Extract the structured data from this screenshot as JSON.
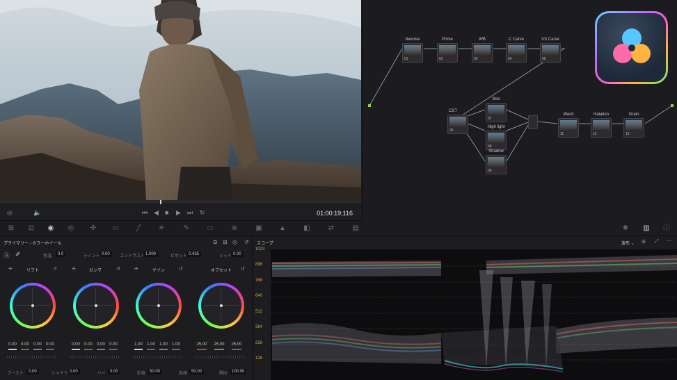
{
  "viewer": {
    "timecode": "01:00:19;116"
  },
  "node_graph": {
    "nodes": [
      {
        "label": "denoise",
        "num": "01"
      },
      {
        "label": "Prime",
        "num": "02"
      },
      {
        "label": "WB",
        "num": "03"
      },
      {
        "label": "C Carve",
        "num": "04"
      },
      {
        "label": "VS Carve",
        "num": "05"
      },
      {
        "label": "CST",
        "num": "06"
      },
      {
        "label": "Skin",
        "num": "07"
      },
      {
        "label": "High light",
        "num": "08"
      },
      {
        "label": "Shadow",
        "num": "09"
      },
      {
        "label": "Wash",
        "num": "11"
      },
      {
        "label": "Halation",
        "num": "12"
      },
      {
        "label": "Grain",
        "num": "13"
      }
    ]
  },
  "primaries": {
    "title": "プライマリー - カラーホイール",
    "params_top": [
      {
        "label": "色温",
        "value": "0.0"
      },
      {
        "label": "ティント",
        "value": "0.00"
      },
      {
        "label": "コントラスト",
        "value": "1.000"
      },
      {
        "label": "ピボット",
        "value": "0.435"
      },
      {
        "label": "ミッド",
        "value": "0.00"
      }
    ],
    "wheels": [
      {
        "title": "リフト",
        "values": [
          "0.00",
          "0.00",
          "0.00",
          "0.00"
        ]
      },
      {
        "title": "ガンマ",
        "values": [
          "0.00",
          "0.00",
          "0.00",
          "0.00"
        ]
      },
      {
        "title": "ゲイン",
        "values": [
          "1.00",
          "1.00",
          "1.00",
          "1.00"
        ]
      },
      {
        "title": "オフセット",
        "values": [
          "25.00",
          "25.00",
          "25.00"
        ]
      }
    ],
    "params_bottom": [
      {
        "label": "ブースト",
        "value": "0.00"
      },
      {
        "label": "シャドウ",
        "value": "0.00"
      },
      {
        "label": "ハイ",
        "value": "0.00"
      },
      {
        "label": "彩度",
        "value": "50.00"
      },
      {
        "label": "色相",
        "value": "50.00"
      },
      {
        "label": "輝M",
        "value": "100.00"
      }
    ]
  },
  "scope": {
    "title": "スコープ",
    "mode": "波形",
    "y_labels": [
      "1023",
      "896",
      "768",
      "640",
      "512",
      "384",
      "256",
      "128"
    ]
  }
}
